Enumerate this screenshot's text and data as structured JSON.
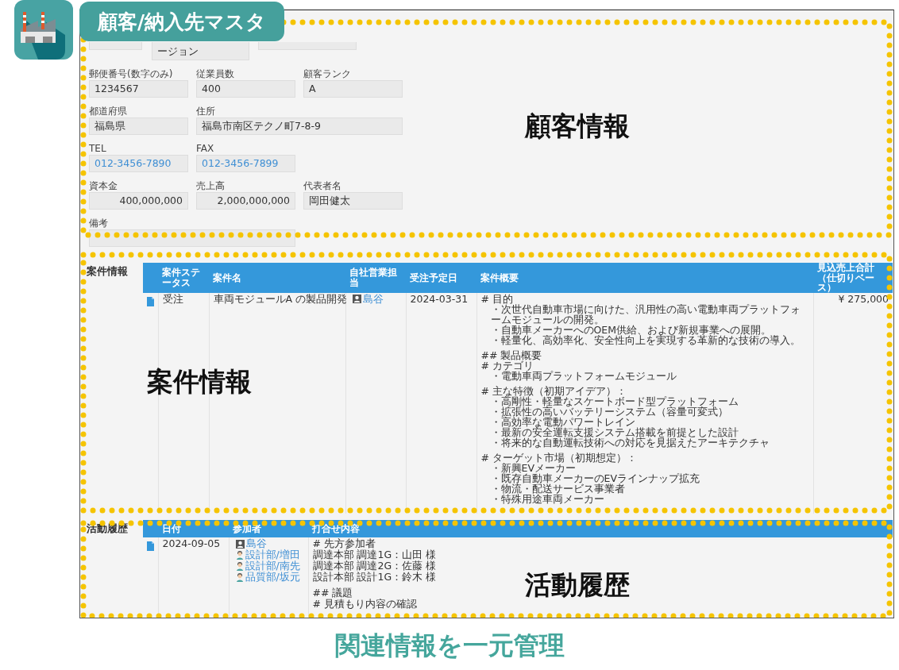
{
  "app": {
    "title": "顧客/納入先マスタ"
  },
  "customer_form": {
    "partial_row": [
      {
        "kind": "empty"
      },
      {
        "kind": "text",
        "value": "ージョン"
      },
      {
        "kind": "empty"
      }
    ],
    "rows": [
      [
        {
          "label": "郵便番号(数字のみ)",
          "value": "1234567",
          "kind": "text"
        },
        {
          "label": "従業員数",
          "value": "400",
          "kind": "text"
        },
        {
          "label": "顧客ランク",
          "value": "A",
          "kind": "text"
        }
      ],
      [
        {
          "label": "都道府県",
          "value": "福島県",
          "kind": "text"
        },
        {
          "label": "住所",
          "value": "福島市南区テクノ町7-8-9",
          "kind": "wide"
        }
      ],
      [
        {
          "label": "TEL",
          "value": "012-3456-7890",
          "kind": "link"
        },
        {
          "label": "FAX",
          "value": "012-3456-7899",
          "kind": "link"
        }
      ],
      [
        {
          "label": "資本金",
          "value": "400,000,000",
          "kind": "amount"
        },
        {
          "label": "売上高",
          "value": "2,000,000,000",
          "kind": "amount"
        },
        {
          "label": "代表者名",
          "value": "岡田健太",
          "kind": "text"
        }
      ],
      [
        {
          "label": "備考",
          "kind": "memo"
        }
      ]
    ]
  },
  "cases": {
    "title": "案件情報",
    "columns": [
      "案件ステータス",
      "案件名",
      "自社営業担当",
      "受注予定日",
      "案件概要",
      "見込売上合計（仕切りベース）"
    ],
    "rows": [
      {
        "status": "受注",
        "name": "車両モジュールA の製品開発",
        "owner": "島谷",
        "due": "2024-03-31",
        "amount": "¥ 275,000",
        "summary": [
          [
            {
              "text": "# 目的",
              "children": [
                {
                  "text": "・次世代自動車市場に向けた、汎用性の高い電動車両プラットフォームモジュールの開発。"
                },
                {
                  "text": "・自動車メーカーへのOEM供給、および新規事業への展開。"
                },
                {
                  "text": "・軽量化、高効率化、安全性向上を実現する革新的な技術の導入。"
                }
              ]
            }
          ],
          [
            {
              "text": "## 製品概要"
            },
            {
              "text": "# カテゴリ",
              "children": [
                {
                  "text": "・電動車両プラットフォームモジュール"
                }
              ]
            }
          ],
          [
            {
              "text": "# 主な特徴（初期アイデア）：",
              "children": [
                {
                  "text": "・高剛性・軽量なスケートボード型プラットフォーム"
                },
                {
                  "text": "・拡張性の高いバッテリーシステム（容量可変式）"
                },
                {
                  "text": "・高効率な電動パワートレイン"
                },
                {
                  "text": "・最新の安全運転支援システム搭載を前提とした設計"
                },
                {
                  "text": "・将来的な自動運転技術への対応を見据えたアーキテクチャ"
                }
              ]
            }
          ],
          [
            {
              "text": "# ターゲット市場（初期想定）：",
              "children": [
                {
                  "text": "・新興EVメーカー"
                },
                {
                  "text": "・既存自動車メーカーのEVラインナップ拡充"
                },
                {
                  "text": "・物流・配送サービス事業者"
                },
                {
                  "text": "・特殊用途車両メーカー"
                }
              ]
            }
          ]
        ]
      }
    ]
  },
  "activities": {
    "title": "活動履歴",
    "columns": [
      "日付",
      "参加者",
      "打合せ内容"
    ],
    "rows": [
      {
        "date": "2024-09-05",
        "participants": [
          {
            "name": "島谷",
            "kind": "user"
          },
          {
            "name": "設計部/増田",
            "kind": "contact"
          },
          {
            "name": "設計部/南先",
            "kind": "contact"
          },
          {
            "name": "品質部/坂元",
            "kind": "contact"
          }
        ],
        "notes": [
          [
            {
              "text": "# 先方参加者"
            },
            {
              "text": "調達本部 調達1G：山田 様"
            },
            {
              "text": "調達本部 調達2G：佐藤 様"
            },
            {
              "text": "設計本部 設計1G：鈴木 様"
            }
          ],
          [
            {
              "text": "## 議題"
            },
            {
              "text": "# 見積もり内容の確認"
            }
          ]
        ]
      }
    ]
  },
  "annotations": [
    {
      "label": "顧客情報"
    },
    {
      "label": "案件情報"
    },
    {
      "label": "活動履歴"
    }
  ],
  "caption": "関連情報を一元管理"
}
